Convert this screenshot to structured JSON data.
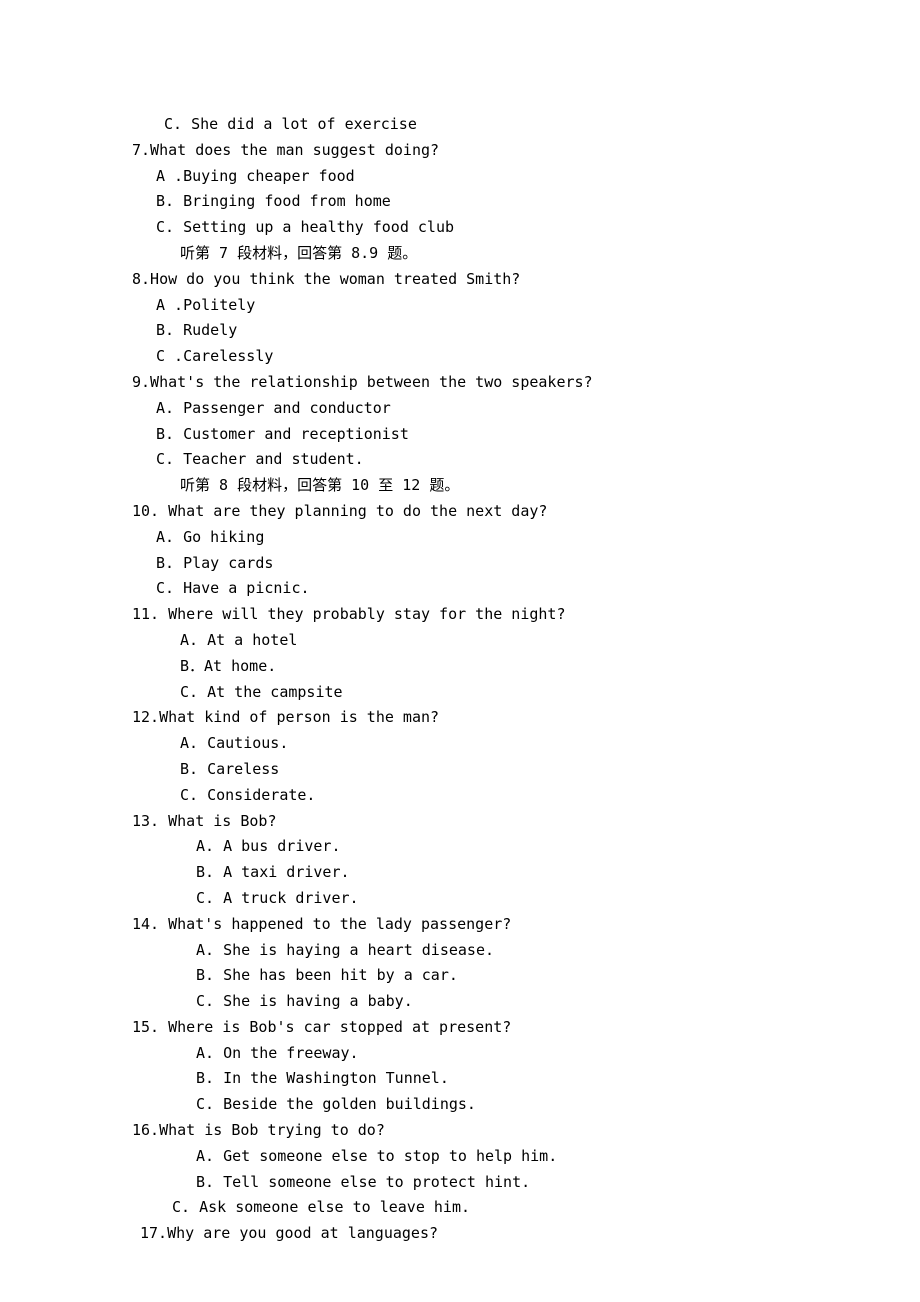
{
  "lines": [
    {
      "indent": "indent-1",
      "text": "C. She did a lot of exercise"
    },
    {
      "indent": "",
      "text": "7.What does the man suggest doing?"
    },
    {
      "indent": "indent-2",
      "text": "A .Buying cheaper food"
    },
    {
      "indent": "indent-2",
      "text": "B. Bringing food from home"
    },
    {
      "indent": "indent-2",
      "text": "C. Setting up a healthy food club"
    },
    {
      "indent": "indent-3",
      "text": "听第 7 段材料，回答第 8.9 题。"
    },
    {
      "indent": "",
      "text": "8.How do you think the woman treated Smith?"
    },
    {
      "indent": "indent-2",
      "text": "A .Politely"
    },
    {
      "indent": "indent-2",
      "text": "B. Rudely"
    },
    {
      "indent": "indent-2",
      "text": "C .Carelessly"
    },
    {
      "indent": "",
      "text": "9.What's the relationship between the two speakers?"
    },
    {
      "indent": "indent-2",
      "text": "A. Passenger and conductor"
    },
    {
      "indent": "indent-2",
      "text": "B. Customer and receptionist"
    },
    {
      "indent": "indent-2",
      "text": "C. Teacher and student."
    },
    {
      "indent": "indent-3",
      "text": "听第 8 段材料，回答第 10 至 12 题。"
    },
    {
      "indent": "",
      "text": "10. What are they planning to do the next day?"
    },
    {
      "indent": "indent-2",
      "text": "A. Go hiking"
    },
    {
      "indent": "indent-2",
      "text": "B. Play cards"
    },
    {
      "indent": "indent-2",
      "text": "C. Have a picnic."
    },
    {
      "indent": "",
      "text": "11. Where will they probably stay for the night?"
    },
    {
      "indent": "indent-3",
      "text": "A. At a hotel"
    },
    {
      "indent": "indent-3",
      "text": "B．At home."
    },
    {
      "indent": "indent-3",
      "text": "C. At the campsite"
    },
    {
      "indent": "",
      "text": "12.What kind of person is the man?"
    },
    {
      "indent": "indent-3",
      "text": "A. Cautious."
    },
    {
      "indent": "indent-3",
      "text": "B. Careless"
    },
    {
      "indent": "indent-3",
      "text": "C. Considerate."
    },
    {
      "indent": "",
      "text": "13. What is Bob?"
    },
    {
      "indent": "indent-4",
      "text": "A. A bus driver."
    },
    {
      "indent": "indent-4",
      "text": "B. A taxi driver."
    },
    {
      "indent": "indent-4",
      "text": "C. A truck driver."
    },
    {
      "indent": "",
      "text": "14. What's happened to the lady passenger?"
    },
    {
      "indent": "indent-4",
      "text": "A. She is haying a heart disease."
    },
    {
      "indent": "indent-4",
      "text": "B. She has been hit by a car."
    },
    {
      "indent": "indent-4",
      "text": "C. She is having a baby."
    },
    {
      "indent": "",
      "text": "15. Where is Bob's car stopped at present?"
    },
    {
      "indent": "indent-4",
      "text": "A. On the freeway."
    },
    {
      "indent": "indent-4",
      "text": "B. In the Washington Tunnel."
    },
    {
      "indent": "indent-4",
      "text": "C. Beside the golden buildings."
    },
    {
      "indent": "",
      "text": "16.What is Bob trying to do?"
    },
    {
      "indent": "indent-4",
      "text": "A. Get someone else to stop to help him."
    },
    {
      "indent": "indent-4",
      "text": "B. Tell someone else to protect hint."
    },
    {
      "indent": "indent-6",
      "text": "C. Ask someone else to leave him."
    },
    {
      "indent": "indent-7",
      "text": "17.Why are you good at languages?"
    }
  ]
}
